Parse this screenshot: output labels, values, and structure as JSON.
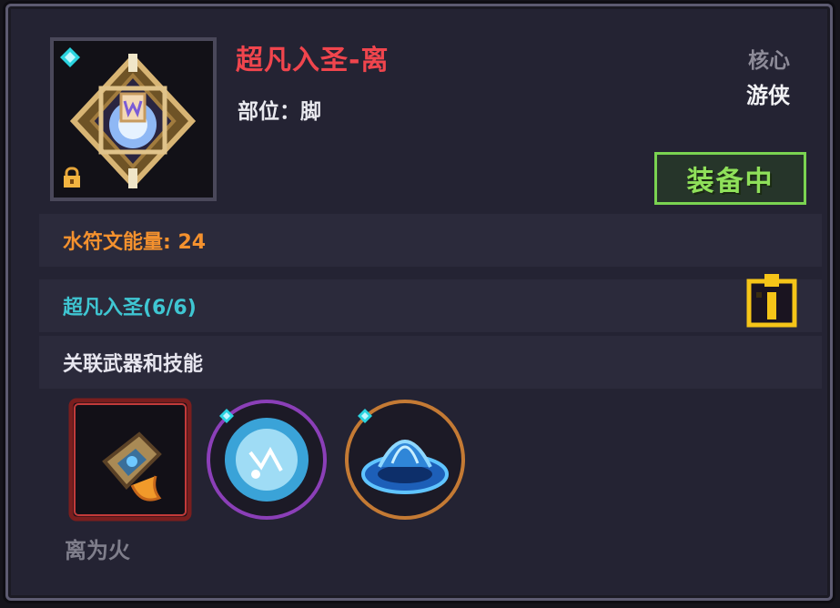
{
  "item": {
    "name": "超凡入圣-离",
    "slot_text": "部位：脚",
    "category": "核心",
    "class_name": "游侠",
    "equip_status": "装备中",
    "icon": "rune-diamond-icon",
    "locked": true
  },
  "stats": {
    "energy_text": "水符文能量: 24"
  },
  "set_bonus": {
    "text": "超凡入圣(6/6)",
    "info_icon": "info-icon"
  },
  "linked": {
    "heading": "关联武器和技能",
    "skills": [
      {
        "icon": "fire-sword-icon",
        "label": "离为火"
      },
      {
        "icon": "ice-orb-icon"
      },
      {
        "icon": "water-vortex-icon"
      }
    ]
  },
  "colors": {
    "title": "#f0454d",
    "energy": "#f4912e",
    "set": "#3fc6d2",
    "equip_border": "#7ad351",
    "info_icon": "#f5c518"
  }
}
